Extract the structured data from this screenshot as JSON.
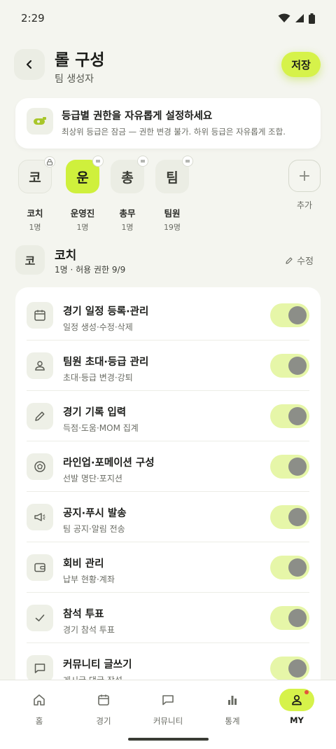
{
  "status_bar": {
    "time": "2:29",
    "icons": [
      "wifi-icon",
      "signal-icon",
      "battery-icon"
    ]
  },
  "header": {
    "back_icon": "chevron-left-icon",
    "title": "롤 구성",
    "subtitle": "팀 생성자",
    "save_label": "저장"
  },
  "info": {
    "icon": "whistle-icon",
    "title": "등급별 권한을 자유롭게 설정하세요",
    "desc": "최상위 등급은 잠금 — 권한 변경 불가. 하위 등급은 자유롭게 조합."
  },
  "grades": [
    {
      "char": "코",
      "name": "코치",
      "count": "1명",
      "badge": "lock-icon",
      "state": "locked"
    },
    {
      "char": "운",
      "name": "운영진",
      "count": "1명",
      "badge": "drag-handle-icon",
      "state": "active"
    },
    {
      "char": "총",
      "name": "총무",
      "count": "1명",
      "badge": "drag-handle-icon",
      "state": "normal"
    },
    {
      "char": "팀",
      "name": "팀원",
      "count": "19명",
      "badge": "drag-handle-icon",
      "state": "normal"
    }
  ],
  "add_grade": {
    "symbol": "+",
    "label": "추가"
  },
  "section": {
    "char": "코",
    "title": "코치",
    "meta": "1명 · 허용 권한 9/9",
    "edit_label": "수정"
  },
  "permissions": [
    {
      "icon": "calendar-icon",
      "title": "경기 일정 등록·관리",
      "desc": "일정 생성·수정·삭제",
      "enabled": true
    },
    {
      "icon": "user-icon",
      "title": "팀원 초대·등급 관리",
      "desc": "초대·등급 변경·강퇴",
      "enabled": true
    },
    {
      "icon": "pencil-icon",
      "title": "경기 기록 입력",
      "desc": "득점·도움·MOM 집계",
      "enabled": true
    },
    {
      "icon": "soccer-ball-icon",
      "title": "라인업·포메이션 구성",
      "desc": "선발 명단·포지션",
      "enabled": true
    },
    {
      "icon": "megaphone-icon",
      "title": "공지·푸시 발송",
      "desc": "팀 공지·알림 전송",
      "enabled": true
    },
    {
      "icon": "wallet-icon",
      "title": "회비 관리",
      "desc": "납부 현황·계좌",
      "enabled": true
    },
    {
      "icon": "check-icon",
      "title": "참석 투표",
      "desc": "경기 참석 투표",
      "enabled": true
    },
    {
      "icon": "chat-icon",
      "title": "커뮤니티 글쓰기",
      "desc": "게시글·댓글 작성",
      "enabled": true
    }
  ],
  "nav": [
    {
      "icon": "home-icon",
      "label": "홈",
      "active": false
    },
    {
      "icon": "calendar-icon",
      "label": "경기",
      "active": false
    },
    {
      "icon": "chat-icon",
      "label": "커뮤니티",
      "active": false
    },
    {
      "icon": "bar-chart-icon",
      "label": "통계",
      "active": false
    },
    {
      "icon": "profile-icon",
      "label": "MY",
      "active": true
    }
  ],
  "colors": {
    "accent": "#d6f24a",
    "background": "#f4f5ef",
    "toggle_on": "#e6f6a8",
    "notification": "#e5533d"
  }
}
